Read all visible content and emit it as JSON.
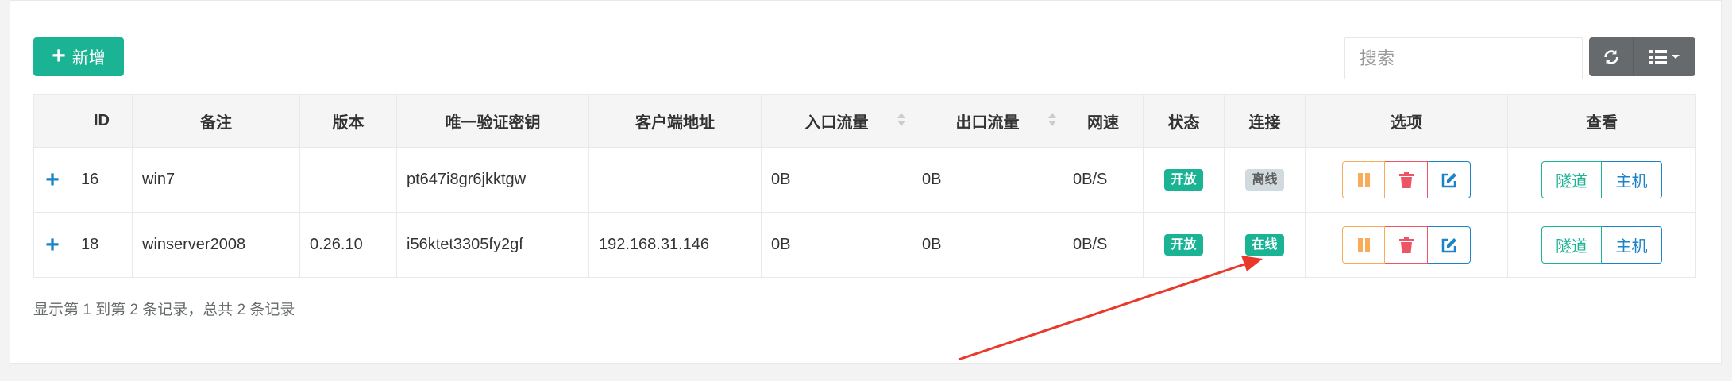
{
  "toolbar": {
    "add_label": "新增",
    "search_placeholder": "搜索"
  },
  "table": {
    "headers": [
      "",
      "ID",
      "备注",
      "版本",
      "唯一验证密钥",
      "客户端地址",
      "入口流量",
      "出口流量",
      "网速",
      "状态",
      "连接",
      "选项",
      "查看"
    ],
    "rows": [
      {
        "expand": "+",
        "id": "16",
        "remark": "win7",
        "version": "",
        "key": "pt647i8gr6jkktgw",
        "client_addr": "",
        "in_traffic": "0B",
        "out_traffic": "0B",
        "speed": "0B/S",
        "status": "开放",
        "connection": "离线",
        "connection_state": "offline",
        "view_tunnel": "隧道",
        "view_host": "主机"
      },
      {
        "expand": "+",
        "id": "18",
        "remark": "winserver2008",
        "version": "0.26.10",
        "key": "i56ktet3305fy2gf",
        "client_addr": "192.168.31.146",
        "in_traffic": "0B",
        "out_traffic": "0B",
        "speed": "0B/S",
        "status": "开放",
        "connection": "在线",
        "connection_state": "online",
        "view_tunnel": "隧道",
        "view_host": "主机"
      }
    ]
  },
  "pagination": {
    "summary": "显示第 1 到第 2 条记录，总共 2 条记录"
  },
  "colors": {
    "primary": "#1ab394",
    "warning": "#f8ac59",
    "danger": "#ed5565",
    "info": "#1c84c6",
    "annotation_arrow": "#e8392b"
  }
}
